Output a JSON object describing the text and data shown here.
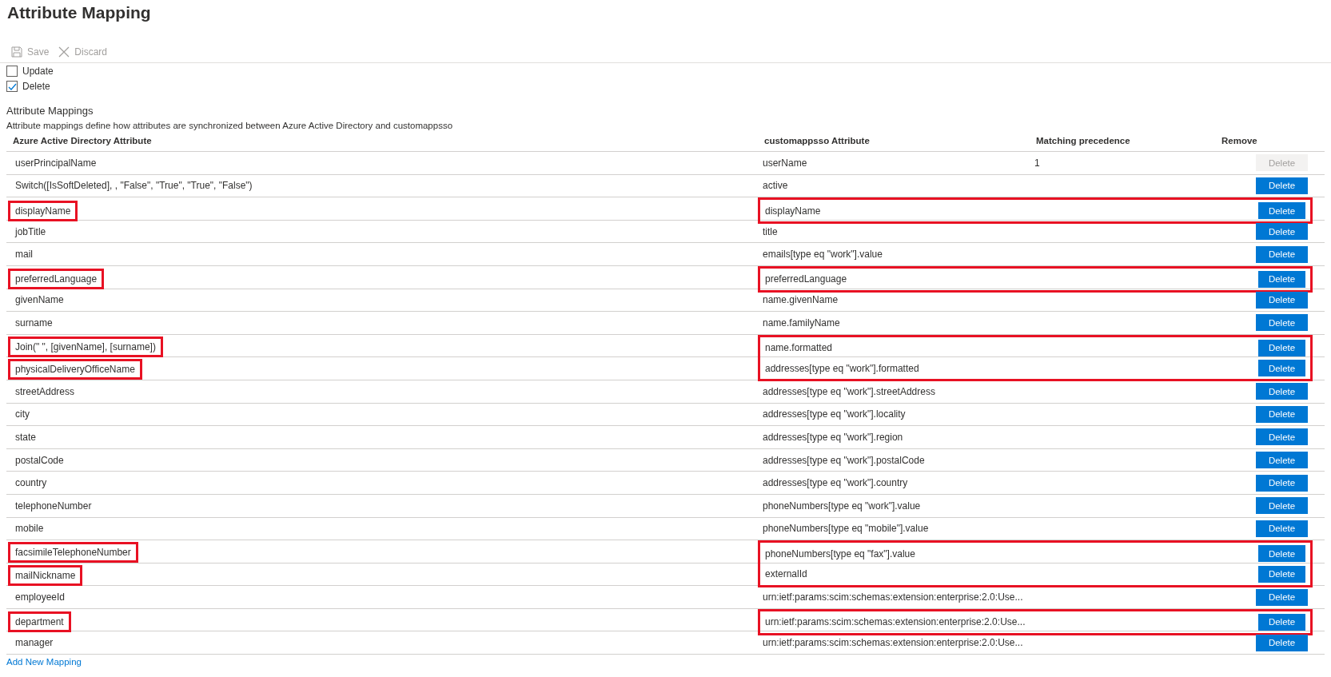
{
  "title": "Attribute Mapping",
  "toolbar": [
    {
      "kind": "save",
      "label": "Save",
      "disabled": true
    },
    {
      "kind": "discard",
      "label": "Discard",
      "disabled": true
    }
  ],
  "actions": [
    {
      "label": "Update",
      "checked": false
    },
    {
      "label": "Delete",
      "checked": true
    }
  ],
  "section": {
    "title": "Attribute Mappings",
    "description": "Attribute mappings define how attributes are synchronized between Azure Active Directory and customappsso"
  },
  "columns": [
    "Azure Active Directory Attribute",
    "customappsso Attribute",
    "Matching precedence",
    "Remove"
  ],
  "rows": [
    {
      "source": "userPrincipalName",
      "target": "userName",
      "precedence": "1",
      "button": "Delete",
      "disabled": true,
      "highlighted": false
    },
    {
      "source": "Switch([IsSoftDeleted], , \"False\", \"True\", \"True\", \"False\")",
      "target": "active",
      "button": "Delete",
      "disabled": false,
      "highlighted": false
    },
    {
      "source": "displayName",
      "target": "displayName",
      "button": "Delete",
      "disabled": false,
      "highlighted": true
    },
    {
      "source": "jobTitle",
      "target": "title",
      "button": "Delete",
      "disabled": false,
      "highlighted": false
    },
    {
      "source": "mail",
      "target": "emails[type eq \"work\"].value",
      "button": "Delete",
      "disabled": false,
      "highlighted": false
    },
    {
      "source": "preferredLanguage",
      "target": "preferredLanguage",
      "button": "Delete",
      "disabled": false,
      "highlighted": true
    },
    {
      "source": "givenName",
      "target": "name.givenName",
      "button": "Delete",
      "disabled": false,
      "highlighted": false
    },
    {
      "source": "surname",
      "target": "name.familyName",
      "button": "Delete",
      "disabled": false,
      "highlighted": false
    },
    {
      "source": "Join(\" \", [givenName], [surname])",
      "target": "name.formatted",
      "button": "Delete",
      "disabled": false,
      "highlighted": true
    },
    {
      "source": "physicalDeliveryOfficeName",
      "target": "addresses[type eq \"work\"].formatted",
      "button": "Delete",
      "disabled": false,
      "highlighted": true
    },
    {
      "source": "streetAddress",
      "target": "addresses[type eq \"work\"].streetAddress",
      "button": "Delete",
      "disabled": false,
      "highlighted": false
    },
    {
      "source": "city",
      "target": "addresses[type eq \"work\"].locality",
      "button": "Delete",
      "disabled": false,
      "highlighted": false
    },
    {
      "source": "state",
      "target": "addresses[type eq \"work\"].region",
      "button": "Delete",
      "disabled": false,
      "highlighted": false
    },
    {
      "source": "postalCode",
      "target": "addresses[type eq \"work\"].postalCode",
      "button": "Delete",
      "disabled": false,
      "highlighted": false
    },
    {
      "source": "country",
      "target": "addresses[type eq \"work\"].country",
      "button": "Delete",
      "disabled": false,
      "highlighted": false
    },
    {
      "source": "telephoneNumber",
      "target": "phoneNumbers[type eq \"work\"].value",
      "button": "Delete",
      "disabled": false,
      "highlighted": false
    },
    {
      "source": "mobile",
      "target": "phoneNumbers[type eq \"mobile\"].value",
      "button": "Delete",
      "disabled": false,
      "highlighted": false
    },
    {
      "source": "facsimileTelephoneNumber",
      "target": "phoneNumbers[type eq \"fax\"].value",
      "button": "Delete",
      "disabled": false,
      "highlighted": true
    },
    {
      "source": "mailNickname",
      "target": "externalId",
      "button": "Delete",
      "disabled": false,
      "highlighted": true
    },
    {
      "source": "employeeId",
      "target": "urn:ietf:params:scim:schemas:extension:enterprise:2.0:Use...",
      "button": "Delete",
      "disabled": false,
      "highlighted": false
    },
    {
      "source": "department",
      "target": "urn:ietf:params:scim:schemas:extension:enterprise:2.0:Use...",
      "button": "Delete",
      "disabled": false,
      "highlighted": true
    },
    {
      "source": "manager",
      "target": "urn:ietf:params:scim:schemas:extension:enterprise:2.0:Use...",
      "button": "Delete",
      "disabled": false,
      "highlighted": false
    }
  ],
  "add_link": "Add New Mapping"
}
